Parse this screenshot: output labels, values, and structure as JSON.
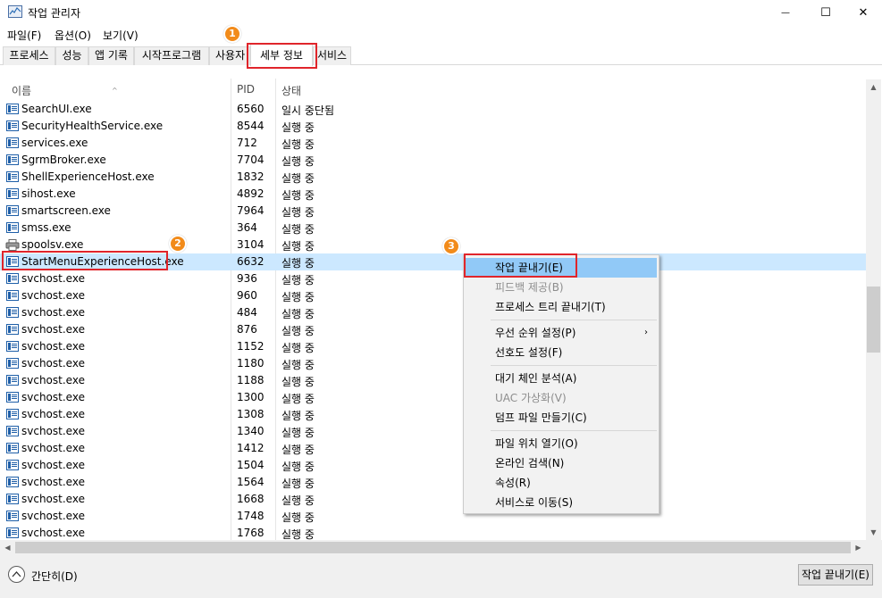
{
  "window": {
    "title": "작업 관리자",
    "minimize_glyph": "—",
    "maximize_glyph": "☐",
    "close_glyph": "✕"
  },
  "menu": [
    "파일(F)",
    "옵션(O)",
    "보기(V)"
  ],
  "tabs": [
    "프로세스",
    "성능",
    "앱 기록",
    "시작프로그램",
    "사용자",
    "세부 정보",
    "서비스"
  ],
  "active_tab": "세부 정보",
  "columns": {
    "name": "이름",
    "pid": "PID",
    "status": "상태"
  },
  "rows": [
    {
      "name": "SearchUI.exe",
      "pid": "6560",
      "status": "일시 중단됨",
      "icon": "app-icon"
    },
    {
      "name": "SecurityHealthService.exe",
      "pid": "8544",
      "status": "실행 중",
      "icon": "app-icon"
    },
    {
      "name": "services.exe",
      "pid": "712",
      "status": "실행 중",
      "icon": "app-icon"
    },
    {
      "name": "SgrmBroker.exe",
      "pid": "7704",
      "status": "실행 중",
      "icon": "app-icon"
    },
    {
      "name": "ShellExperienceHost.exe",
      "pid": "1832",
      "status": "실행 중",
      "icon": "app-icon"
    },
    {
      "name": "sihost.exe",
      "pid": "4892",
      "status": "실행 중",
      "icon": "app-icon"
    },
    {
      "name": "smartscreen.exe",
      "pid": "7964",
      "status": "실행 중",
      "icon": "app-icon"
    },
    {
      "name": "smss.exe",
      "pid": "364",
      "status": "실행 중",
      "icon": "app-icon"
    },
    {
      "name": "spoolsv.exe",
      "pid": "3104",
      "status": "실행 중",
      "icon": "printer-icon"
    },
    {
      "name": "StartMenuExperienceHost.exe",
      "pid": "6632",
      "status": "실행 중",
      "icon": "app-icon",
      "selected": true
    },
    {
      "name": "svchost.exe",
      "pid": "936",
      "status": "실행 중",
      "icon": "app-icon"
    },
    {
      "name": "svchost.exe",
      "pid": "960",
      "status": "실행 중",
      "icon": "app-icon"
    },
    {
      "name": "svchost.exe",
      "pid": "484",
      "status": "실행 중",
      "icon": "app-icon"
    },
    {
      "name": "svchost.exe",
      "pid": "876",
      "status": "실행 중",
      "icon": "app-icon"
    },
    {
      "name": "svchost.exe",
      "pid": "1152",
      "status": "실행 중",
      "icon": "app-icon"
    },
    {
      "name": "svchost.exe",
      "pid": "1180",
      "status": "실행 중",
      "icon": "app-icon"
    },
    {
      "name": "svchost.exe",
      "pid": "1188",
      "status": "실행 중",
      "icon": "app-icon"
    },
    {
      "name": "svchost.exe",
      "pid": "1300",
      "status": "실행 중",
      "icon": "app-icon"
    },
    {
      "name": "svchost.exe",
      "pid": "1308",
      "status": "실행 중",
      "icon": "app-icon"
    },
    {
      "name": "svchost.exe",
      "pid": "1340",
      "status": "실행 중",
      "icon": "app-icon"
    },
    {
      "name": "svchost.exe",
      "pid": "1412",
      "status": "실행 중",
      "icon": "app-icon"
    },
    {
      "name": "svchost.exe",
      "pid": "1504",
      "status": "실행 중",
      "icon": "app-icon"
    },
    {
      "name": "svchost.exe",
      "pid": "1564",
      "status": "실행 중",
      "icon": "app-icon"
    },
    {
      "name": "svchost.exe",
      "pid": "1668",
      "status": "실행 중",
      "icon": "app-icon"
    },
    {
      "name": "svchost.exe",
      "pid": "1748",
      "status": "실행 중",
      "icon": "app-icon"
    },
    {
      "name": "svchost.exe",
      "pid": "1768",
      "status": "실행 중",
      "icon": "app-icon"
    }
  ],
  "context_menu": [
    {
      "label": "작업 끝내기(E)",
      "highlighted": true
    },
    {
      "label": "피드백 제공(B)",
      "disabled": true
    },
    {
      "label": "프로세스 트리 끝내기(T)"
    },
    {
      "separator": true
    },
    {
      "label": "우선 순위 설정(P)",
      "submenu": true
    },
    {
      "label": "선호도 설정(F)"
    },
    {
      "separator": true
    },
    {
      "label": "대기 체인 분석(A)"
    },
    {
      "label": "UAC 가상화(V)",
      "disabled": true
    },
    {
      "label": "덤프 파일 만들기(C)"
    },
    {
      "separator": true
    },
    {
      "label": "파일 위치 열기(O)"
    },
    {
      "label": "온라인 검색(N)"
    },
    {
      "label": "속성(R)"
    },
    {
      "label": "서비스로 이동(S)"
    }
  ],
  "footer": {
    "collapse_label": "간단히(D)",
    "end_task_label": "작업 끝내기(E)"
  },
  "scroll_arrows": {
    "up": "▲",
    "down": "▼",
    "left": "◀",
    "right": "▶"
  },
  "submenu_glyph": "›",
  "sort_glyph": "^",
  "callouts": [
    "1",
    "2",
    "3"
  ],
  "colors": {
    "selection": "#cce8ff",
    "menu_highlight": "#91c9f7",
    "callout_box": "#e0252b",
    "callout_badge": "#f28b1a"
  }
}
